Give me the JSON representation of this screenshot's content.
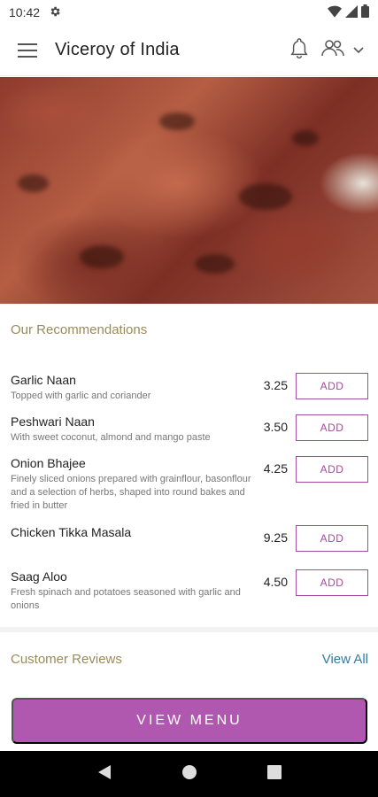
{
  "status_bar": {
    "time": "10:42"
  },
  "app_bar": {
    "title": "Viceroy of India"
  },
  "recommendations": {
    "title": "Our Recommendations",
    "add_label": "ADD",
    "items": [
      {
        "name": "Garlic Naan",
        "description": "Topped with garlic and coriander",
        "price": "3.25"
      },
      {
        "name": "Peshwari Naan",
        "description": "With sweet coconut, almond and mango paste",
        "price": "3.50"
      },
      {
        "name": "Onion Bhajee",
        "description": "Finely sliced onions prepared with grainflour, basonflour and a selection of herbs, shaped into round bakes and fried in butter",
        "price": "4.25"
      },
      {
        "name": "Chicken Tikka Masala",
        "description": "",
        "price": "9.25"
      },
      {
        "name": "Saag Aloo",
        "description": "Fresh spinach and potatoes seasoned with garlic and onions",
        "price": "4.50"
      }
    ]
  },
  "reviews": {
    "title": "Customer Reviews",
    "view_all": "View All"
  },
  "view_menu_button": "VIEW MENU",
  "colors": {
    "accent": "#b057b0",
    "link": "#2b7fa3",
    "section_title": "#9a8a5a"
  }
}
